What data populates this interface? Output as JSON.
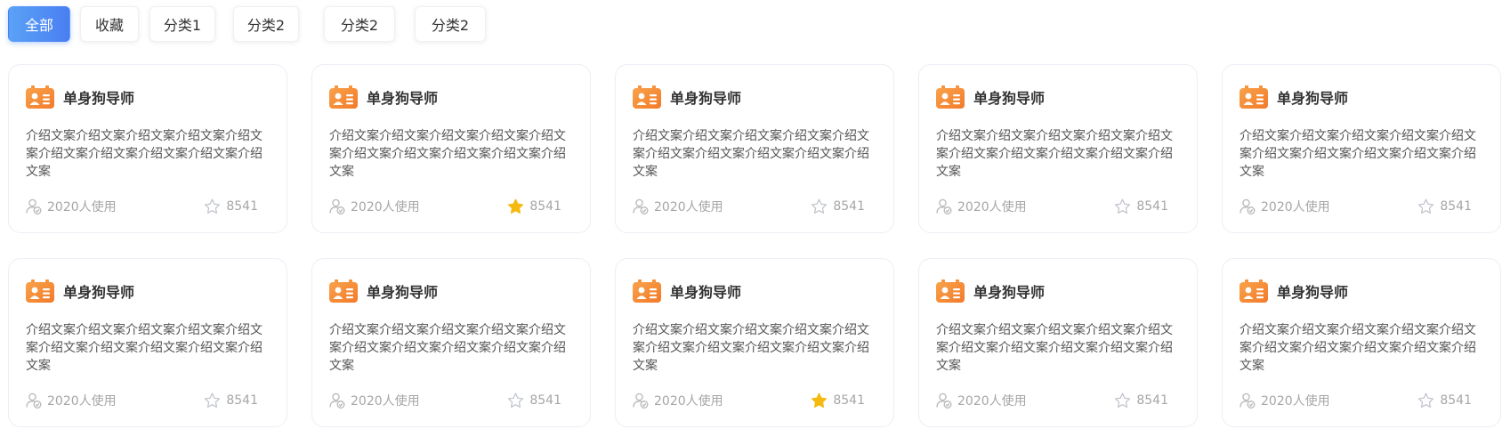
{
  "tabs": [
    {
      "label": "全部",
      "active": true
    },
    {
      "label": "收藏",
      "active": false
    },
    {
      "label": "分类1",
      "active": false
    },
    {
      "label": "分类2",
      "active": false
    },
    {
      "label": "分类2",
      "active": false
    },
    {
      "label": "分类2",
      "active": false
    }
  ],
  "cards": [
    {
      "title": "单身狗导师",
      "desc": "介绍文案介绍文案介绍文案介绍文案介绍文案介绍文案介绍文案介绍文案介绍文案介绍文案",
      "usage": "2020人使用",
      "favorites": "8541",
      "favorited": false
    },
    {
      "title": "单身狗导师",
      "desc": "介绍文案介绍文案介绍文案介绍文案介绍文案介绍文案介绍文案介绍文案介绍文案介绍文案",
      "usage": "2020人使用",
      "favorites": "8541",
      "favorited": true
    },
    {
      "title": "单身狗导师",
      "desc": "介绍文案介绍文案介绍文案介绍文案介绍文案介绍文案介绍文案介绍文案介绍文案介绍文案",
      "usage": "2020人使用",
      "favorites": "8541",
      "favorited": false
    },
    {
      "title": "单身狗导师",
      "desc": "介绍文案介绍文案介绍文案介绍文案介绍文案介绍文案介绍文案介绍文案介绍文案介绍文案",
      "usage": "2020人使用",
      "favorites": "8541",
      "favorited": false
    },
    {
      "title": "单身狗导师",
      "desc": "介绍文案介绍文案介绍文案介绍文案介绍文案介绍文案介绍文案介绍文案介绍文案介绍文案",
      "usage": "2020人使用",
      "favorites": "8541",
      "favorited": false
    },
    {
      "title": "单身狗导师",
      "desc": "介绍文案介绍文案介绍文案介绍文案介绍文案介绍文案介绍文案介绍文案介绍文案介绍文案",
      "usage": "2020人使用",
      "favorites": "8541",
      "favorited": false
    },
    {
      "title": "单身狗导师",
      "desc": "介绍文案介绍文案介绍文案介绍文案介绍文案介绍文案介绍文案介绍文案介绍文案介绍文案",
      "usage": "2020人使用",
      "favorites": "8541",
      "favorited": false
    },
    {
      "title": "单身狗导师",
      "desc": "介绍文案介绍文案介绍文案介绍文案介绍文案介绍文案介绍文案介绍文案介绍文案介绍文案",
      "usage": "2020人使用",
      "favorites": "8541",
      "favorited": true
    },
    {
      "title": "单身狗导师",
      "desc": "介绍文案介绍文案介绍文案介绍文案介绍文案介绍文案介绍文案介绍文案介绍文案介绍文案",
      "usage": "2020人使用",
      "favorites": "8541",
      "favorited": false
    },
    {
      "title": "单身狗导师",
      "desc": "介绍文案介绍文案介绍文案介绍文案介绍文案介绍文案介绍文案介绍文案介绍文案介绍文案",
      "usage": "2020人使用",
      "favorites": "8541",
      "favorited": false
    }
  ],
  "icons": {
    "card_icon": "id-card-icon",
    "usage_icon": "user-check-icon",
    "favorite_icon": "star-icon"
  },
  "colors": {
    "accent": "#4a7ef2",
    "card_icon": "#f7923a",
    "star_active": "#f5b90f",
    "star_inactive": "#c0c4cc",
    "muted_text": "#a6a6a6"
  }
}
